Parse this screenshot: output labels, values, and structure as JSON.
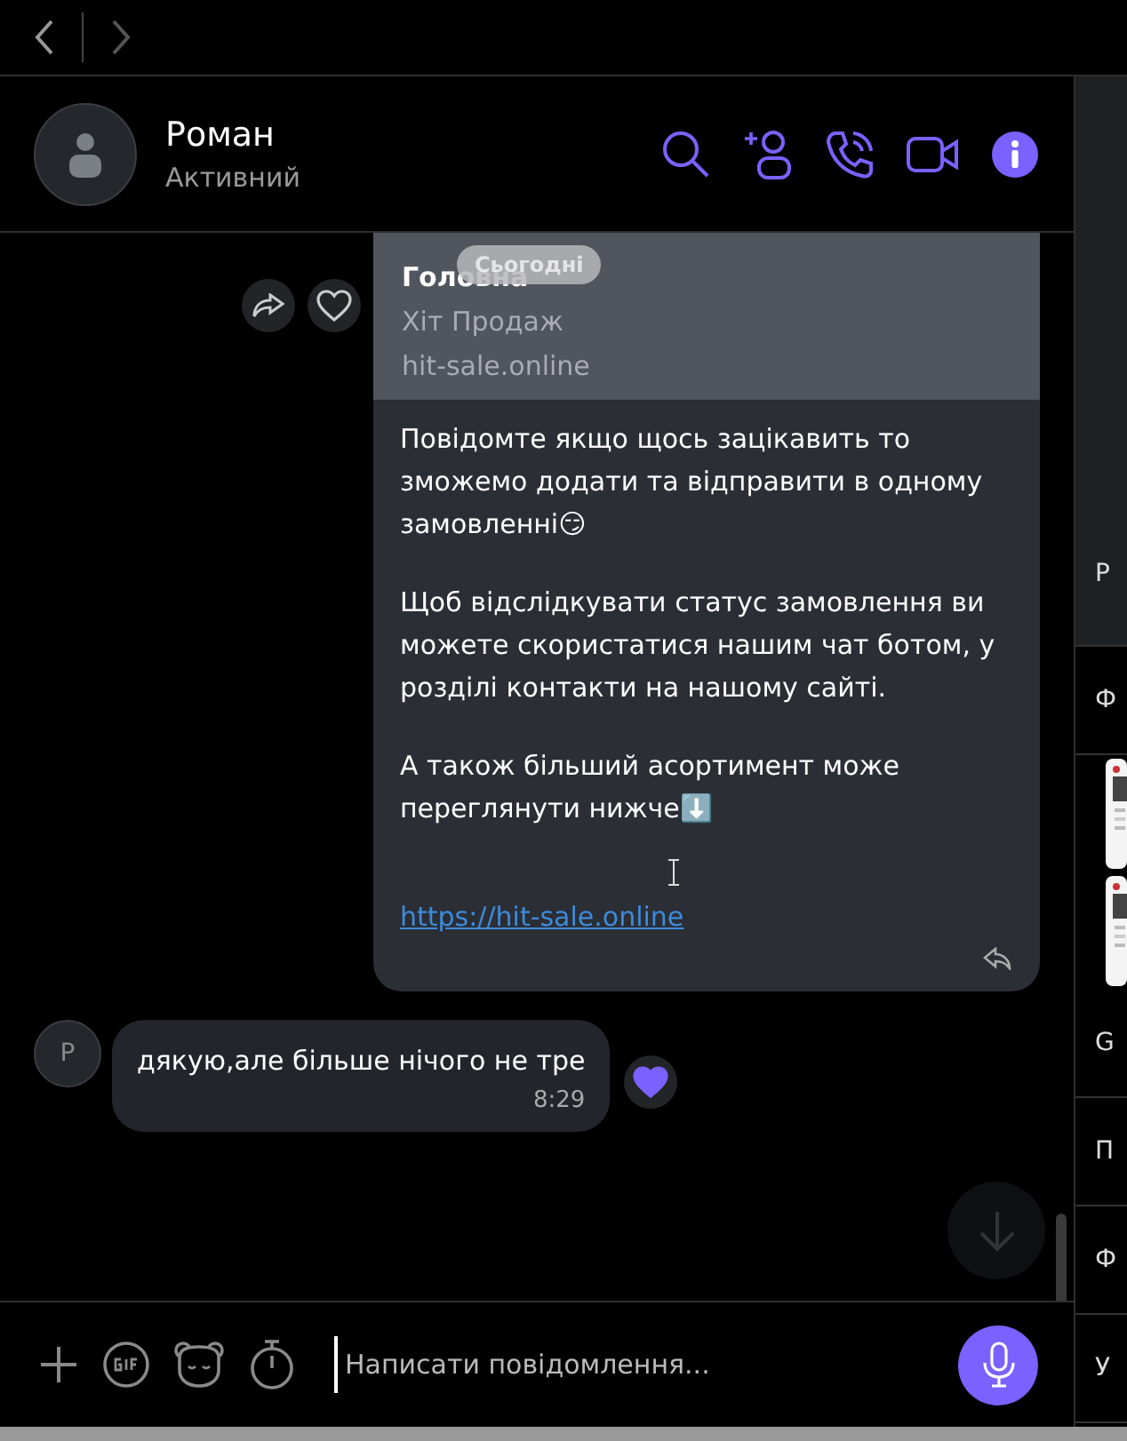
{
  "chat": {
    "name": "Роман",
    "status": "Активний"
  },
  "date_badge": "Сьогодні",
  "messages": [
    {
      "kind": "outgoing",
      "preview": {
        "title": "Головна",
        "subtitle": "Хіт Продаж",
        "domain": "hit-sale.online"
      },
      "paragraphs": [
        "Повідомте якщо щось зацікавить то зможемо додати та відправити в одному замовленні😏",
        "Щоб відслідкувати статус замовлення ви можете скористатися нашим чат ботом, у розділі контакти на нашому сайті.",
        "А також більший асортимент може переглянути  нижче⬇️"
      ],
      "link": "https://hit-sale.online"
    },
    {
      "kind": "incoming",
      "sender_initial": "Р",
      "text": "дякую,але більше нічого не тре",
      "time": "8:29",
      "liked": true
    }
  ],
  "composer": {
    "placeholder": "Написати повідомлення..."
  },
  "sidebar": {
    "items": [
      {
        "kind": "panel",
        "label": "Р"
      },
      {
        "kind": "row",
        "label": "Ф"
      },
      {
        "kind": "picture"
      },
      {
        "kind": "picture"
      },
      {
        "kind": "row",
        "label": "G"
      },
      {
        "kind": "row",
        "label": "П"
      },
      {
        "kind": "row",
        "label": "Ф"
      },
      {
        "kind": "row",
        "label": "У"
      }
    ]
  }
}
